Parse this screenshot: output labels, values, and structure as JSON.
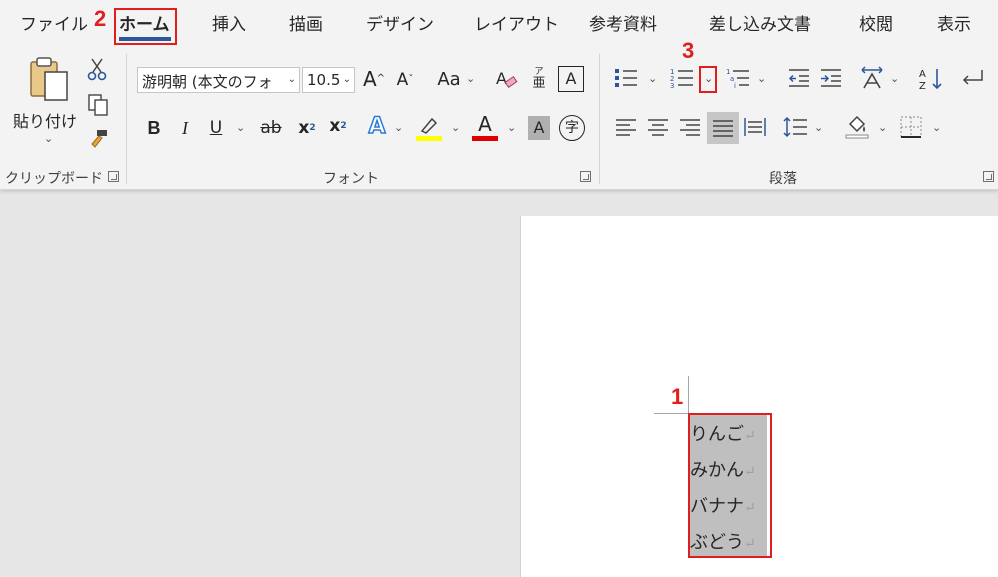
{
  "tabs": [
    {
      "label": "ファイル",
      "active": false
    },
    {
      "label": "ホーム",
      "active": true
    },
    {
      "label": "挿入",
      "active": false
    },
    {
      "label": "描画",
      "active": false
    },
    {
      "label": "デザイン",
      "active": false
    },
    {
      "label": "レイアウト",
      "active": false
    },
    {
      "label": "参考資料",
      "active": false
    },
    {
      "label": "差し込み文書",
      "active": false
    },
    {
      "label": "校閲",
      "active": false
    },
    {
      "label": "表示",
      "active": false
    }
  ],
  "clipboard": {
    "paste_label": "貼り付け",
    "group_label": "クリップボード"
  },
  "font": {
    "font_name": "游明朝 (本文のフォ",
    "font_size": "10.5",
    "grow_label": "A",
    "shrink_label": "A",
    "case_label": "Aa",
    "bold_label": "B",
    "italic_label": "I",
    "underline_label": "U",
    "strike_label": "ab",
    "subscript_label": "x",
    "superscript_label": "x",
    "texteffect_label": "A",
    "fontcolor_label": "A",
    "shading_label": "A",
    "phonetic_label": "亜",
    "phonetic_small": "ア",
    "enclose_label": "字",
    "group_label": "フォント",
    "highlight_color": "#ffff00",
    "font_color": "#e00000"
  },
  "paragraph": {
    "group_label": "段落"
  },
  "document": {
    "items": [
      "りんご",
      "みかん",
      "バナナ",
      "ぶどう"
    ],
    "para_mark": "↵"
  },
  "annotations": {
    "step1": "1",
    "step2": "2",
    "step3": "3",
    "color": "#e01e1e"
  }
}
